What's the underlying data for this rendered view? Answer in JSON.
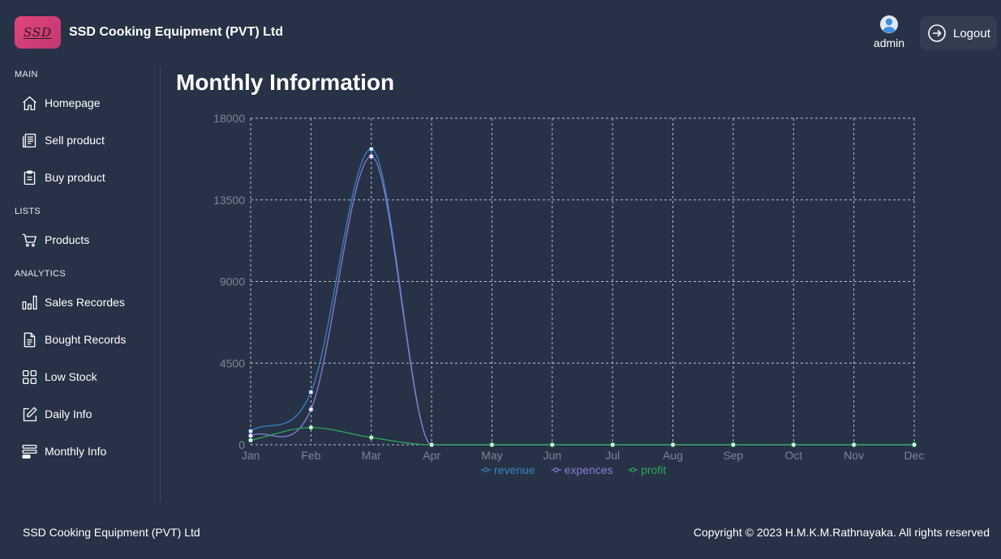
{
  "header": {
    "logo_text": "SSD",
    "company_name": "SSD Cooking Equipment (PVT) Ltd",
    "user_name": "admin",
    "logout_label": "Logout"
  },
  "sidebar": {
    "sections": [
      {
        "label": "MAIN",
        "items": [
          {
            "label": "Homepage",
            "icon": "home-icon"
          },
          {
            "label": "Sell product",
            "icon": "receipt-icon"
          },
          {
            "label": "Buy product",
            "icon": "clipboard-icon"
          }
        ]
      },
      {
        "label": "LISTS",
        "items": [
          {
            "label": "Products",
            "icon": "cart-icon"
          }
        ]
      },
      {
        "label": "ANALYTICS",
        "items": [
          {
            "label": "Sales Recordes",
            "icon": "bar-chart-icon"
          },
          {
            "label": "Bought Records",
            "icon": "document-icon"
          },
          {
            "label": "Low Stock",
            "icon": "grid-icon"
          },
          {
            "label": "Daily Info",
            "icon": "edit-icon"
          },
          {
            "label": "Monthly Info",
            "icon": "list-icon"
          }
        ]
      }
    ]
  },
  "main": {
    "title": "Monthly Information"
  },
  "chart_data": {
    "type": "line",
    "categories": [
      "Jan",
      "Feb",
      "Mar",
      "Apr",
      "May",
      "Jun",
      "Jul",
      "Aug",
      "Sep",
      "Oct",
      "Nov",
      "Dec"
    ],
    "yticks": [
      "0",
      "4500",
      "9000",
      "13500",
      "18000"
    ],
    "ylim": [
      0,
      18000
    ],
    "grid": true,
    "legend_position": "bottom",
    "series": [
      {
        "name": "revenue",
        "color": "#3b82c4",
        "values": [
          750,
          2900,
          16300,
          0,
          0,
          0,
          0,
          0,
          0,
          0,
          0,
          0
        ]
      },
      {
        "name": "expences",
        "color": "#8b7bd8",
        "values": [
          500,
          1950,
          15900,
          0,
          0,
          0,
          0,
          0,
          0,
          0,
          0,
          0
        ]
      },
      {
        "name": "profit",
        "color": "#2ea85a",
        "values": [
          250,
          950,
          400,
          0,
          0,
          0,
          0,
          0,
          0,
          0,
          0,
          0
        ]
      }
    ]
  },
  "footer": {
    "left": "SSD Cooking Equipment (PVT) Ltd",
    "right": "Copyright © 2023 H.M.K.M.Rathnayaka. All rights reserved"
  }
}
